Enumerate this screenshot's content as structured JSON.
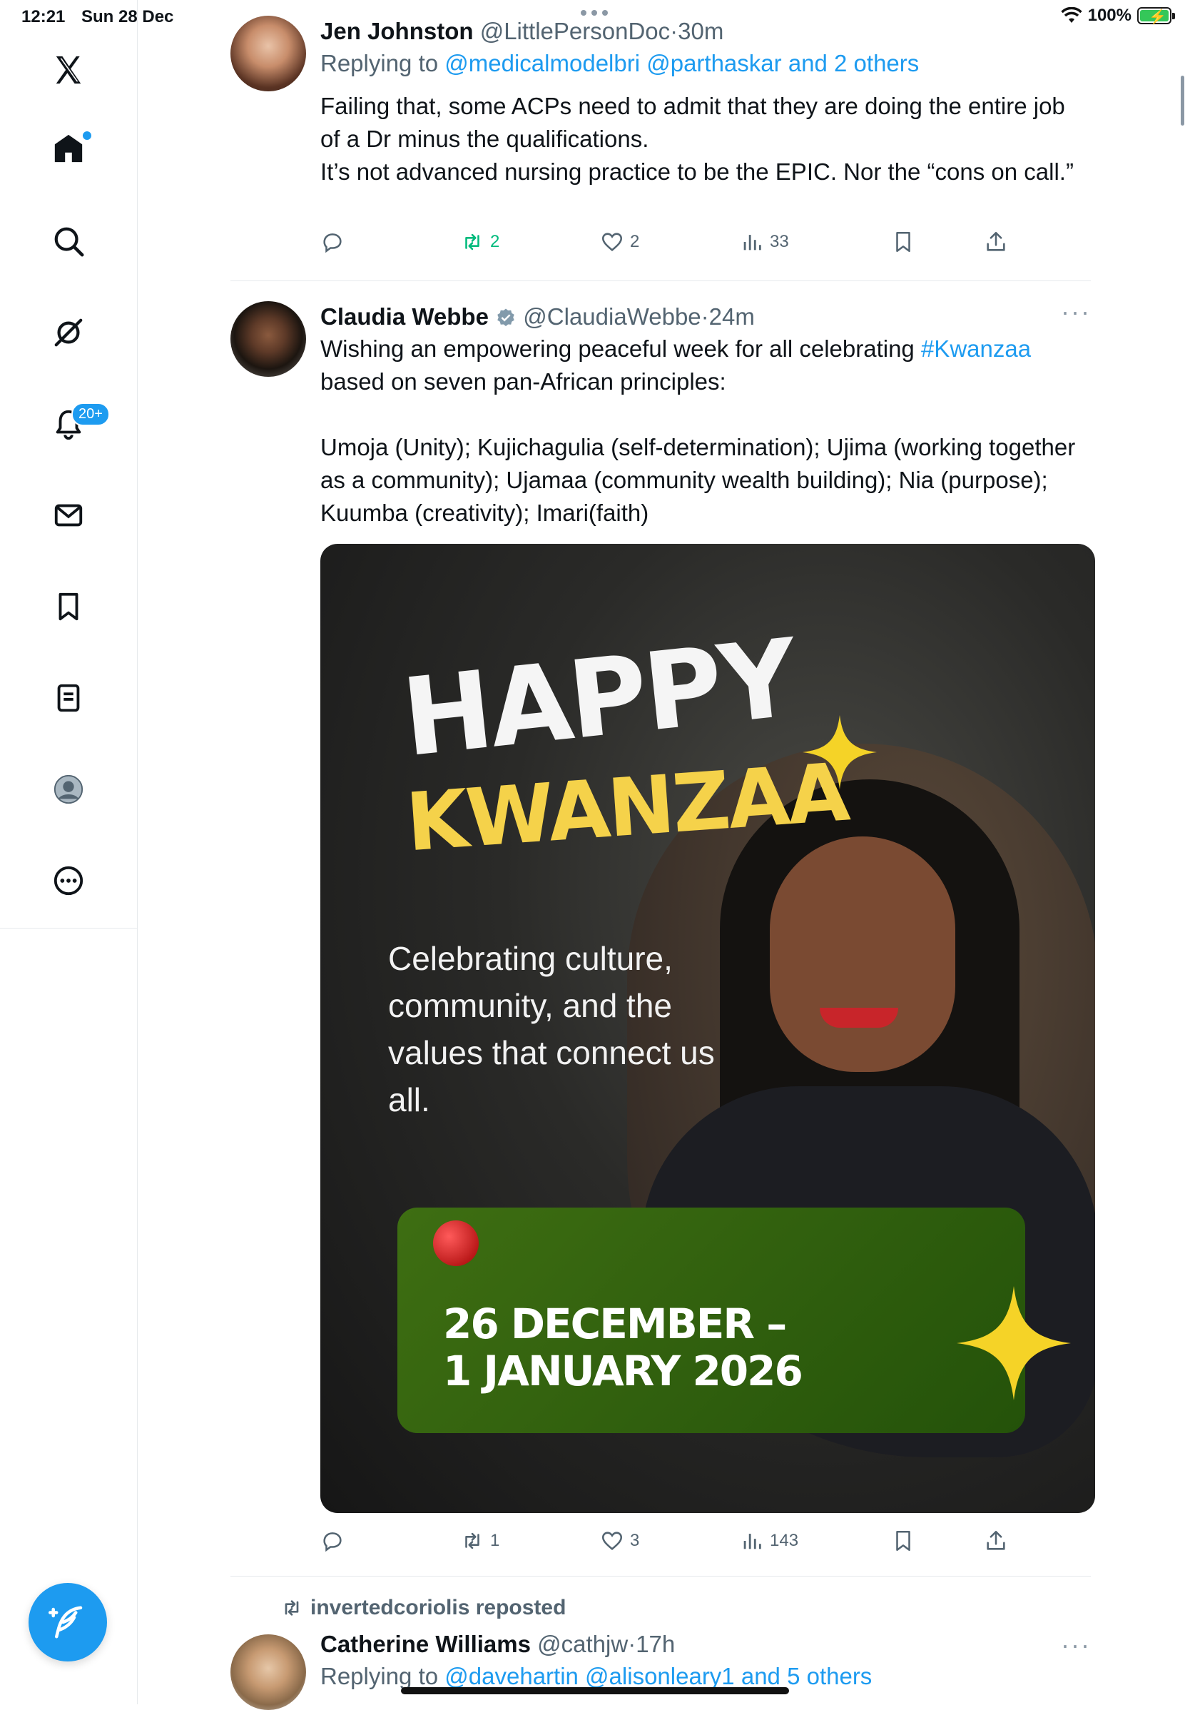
{
  "status_bar": {
    "time": "12:21",
    "date": "Sun 28 Dec",
    "battery": "100%"
  },
  "sidebar": {
    "items": [
      {
        "name": "x-logo"
      },
      {
        "name": "home"
      },
      {
        "name": "search"
      },
      {
        "name": "grok"
      },
      {
        "name": "notifications",
        "badge": "20+"
      },
      {
        "name": "messages"
      },
      {
        "name": "bookmarks"
      },
      {
        "name": "lists"
      },
      {
        "name": "profile"
      },
      {
        "name": "more"
      }
    ]
  },
  "tweets": [
    {
      "name": "Jen Johnston",
      "handle": "@LittlePersonDoc",
      "time": "30m",
      "reply_prefix": "Replying to",
      "reply_users": "@medicalmodelbri @parthaskar",
      "reply_others": "and 2 others",
      "text": "Failing that, some ACPs need to admit that they are doing the entire job of a Dr minus the qualifications.\nIt’s not advanced nursing practice to be the EPIC. Nor the “cons on call.”",
      "stats": {
        "replies": "",
        "reposts": "2",
        "likes": "2",
        "views": "33"
      }
    },
    {
      "name": "Claudia Webbe",
      "handle": "@ClaudiaWebbe",
      "time": "24m",
      "text_before_tag": "Wishing an empowering peaceful week for all celebrating ",
      "hashtag": "#Kwanzaa",
      "text_after_tag": " based on seven pan-African principles:",
      "text_2": "Umoja (Unity); Kujichagulia (self-determination); Ujima (working together as a community); Ujamaa (community wealth building); Nia (purpose); Kuumba (creativity); Imari(faith)",
      "media": {
        "headline_1": "HAPPY",
        "headline_2": "KWANZAA",
        "tagline": "Celebrating culture, community, and the values that connect us all.",
        "date_line_1": "26 DECEMBER –",
        "date_line_2": "1 JANUARY 2026"
      },
      "stats": {
        "replies": "",
        "reposts": "1",
        "likes": "3",
        "views": "143"
      }
    },
    {
      "reposted_by": "invertedcoriolis reposted",
      "name": "Catherine Williams",
      "handle": "@cathjw",
      "time": "17h",
      "reply_prefix": "Replying to",
      "reply_users": "@davehartin @alisonleary1",
      "reply_others": "and 5 others"
    }
  ],
  "colors": {
    "accent": "#1d9bf0",
    "repost_green": "#00ba7c",
    "secondary_text": "#536471"
  }
}
